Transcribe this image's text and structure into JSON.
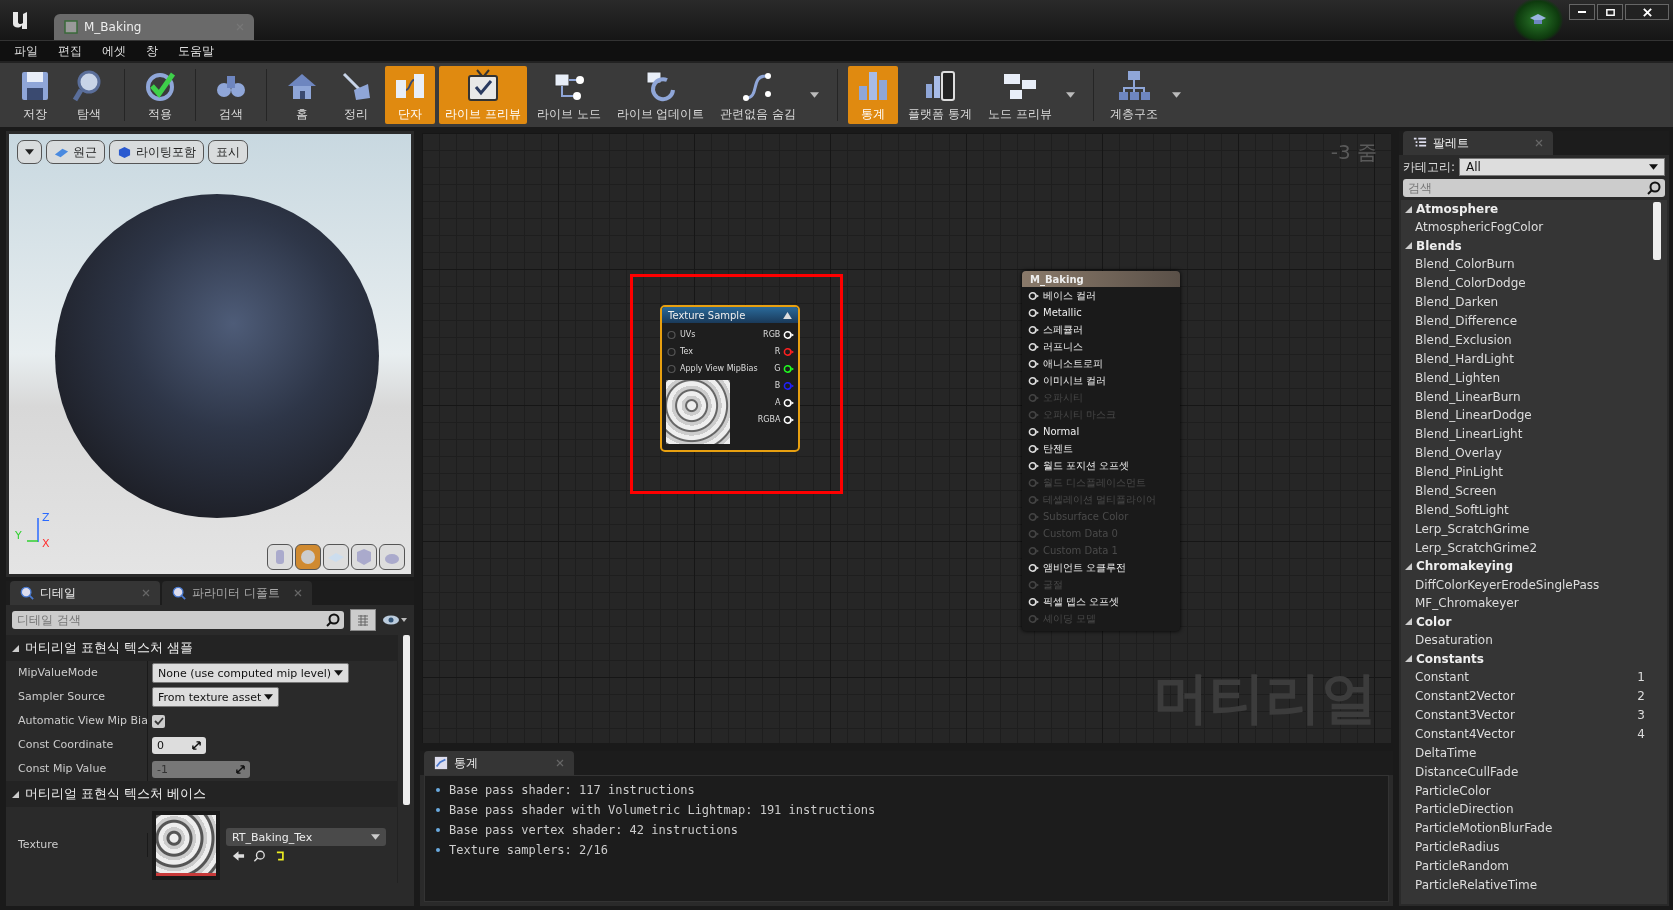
{
  "window": {
    "tab": "M_Baking"
  },
  "menu": [
    "파일",
    "편집",
    "에셋",
    "창",
    "도움말"
  ],
  "toolbar_groups": [
    [
      {
        "label": "저장",
        "selected": false,
        "dropdown": false
      },
      {
        "label": "탐색",
        "selected": false,
        "dropdown": false
      }
    ],
    [
      {
        "label": "적용",
        "selected": false,
        "dropdown": false
      }
    ],
    [
      {
        "label": "검색",
        "selected": false,
        "dropdown": false
      }
    ],
    [
      {
        "label": "홈",
        "selected": false,
        "dropdown": false
      },
      {
        "label": "정리",
        "selected": false,
        "dropdown": false
      },
      {
        "label": "단자",
        "selected": true,
        "dropdown": false
      },
      {
        "label": "라이브 프리뷰",
        "selected": true,
        "dropdown": false
      },
      {
        "label": "라이브 노드",
        "selected": false,
        "dropdown": false
      },
      {
        "label": "라이브 업데이트",
        "selected": false,
        "dropdown": false
      },
      {
        "label": "관련없음 숨김",
        "selected": false,
        "dropdown": true
      }
    ],
    [
      {
        "label": "통계",
        "selected": true,
        "dropdown": false
      },
      {
        "label": "플랫폼 통계",
        "selected": false,
        "dropdown": false
      },
      {
        "label": "노드 프리뷰",
        "selected": false,
        "dropdown": true
      }
    ],
    [
      {
        "label": "계층구조",
        "selected": false,
        "dropdown": true
      }
    ]
  ],
  "viewport": {
    "buttons": [
      {
        "kind": "dropdown"
      },
      {
        "kind": "perspective",
        "label": "원근"
      },
      {
        "kind": "lit",
        "label": "라이팅포함"
      },
      {
        "kind": "text",
        "label": "표시"
      }
    ],
    "axes": {
      "z": "Z",
      "y": "Y",
      "x": "X"
    },
    "shapes": [
      {
        "selected": false
      },
      {
        "selected": true
      },
      {
        "selected": false
      },
      {
        "selected": false
      },
      {
        "selected": false
      }
    ]
  },
  "details": {
    "tabs": [
      {
        "label": "디테일",
        "selected": true
      },
      {
        "label": "파라미터 디폴트",
        "selected": false
      }
    ],
    "search": {
      "placeholder": "디테일 검색"
    },
    "sections": [
      {
        "title": "머티리얼 표현식 텍스처 샘플",
        "expanded": true,
        "properties": [
          {
            "label": "MipValueMode",
            "kind": "dropdown",
            "value": "None (use computed mip level)"
          },
          {
            "label": "Sampler Source",
            "kind": "dropdown",
            "value": "From texture asset"
          },
          {
            "label": "Automatic View Mip Bia",
            "kind": "checkbox",
            "checked": true
          },
          {
            "label": "Const Coordinate",
            "kind": "number",
            "value": "0",
            "disabled": false
          },
          {
            "label": "Const Mip Value",
            "kind": "number",
            "value": "-1",
            "disabled": true
          }
        ]
      },
      {
        "title": "머티리얼 표현식 텍스처 베이스",
        "expanded": true,
        "properties": [
          {
            "label": "Texture",
            "kind": "texture",
            "value": "RT_Baking_Tex"
          }
        ]
      }
    ]
  },
  "graph": {
    "zoom": "-3 줌",
    "type_label": "머티리얼",
    "texture_node": {
      "title": "Texture Sample",
      "selected": true,
      "inputs": [
        "UVs",
        "Tex",
        "Apply View MipBias"
      ],
      "outputs": [
        {
          "label": "RGB",
          "color": "#ffffff"
        },
        {
          "label": "R",
          "color": "#ff2020"
        },
        {
          "label": "G",
          "color": "#20ff20"
        },
        {
          "label": "B",
          "color": "#2020ff"
        },
        {
          "label": "A",
          "color": "#ffffff"
        },
        {
          "label": "RGBA",
          "color": "#ffffff"
        }
      ]
    },
    "result_node": {
      "title": "M_Baking",
      "pins": [
        {
          "label": "베이스 컬러",
          "enabled": true
        },
        {
          "label": "Metallic",
          "enabled": true
        },
        {
          "label": "스페큘러",
          "enabled": true
        },
        {
          "label": "러프니스",
          "enabled": true
        },
        {
          "label": "애니소트로피",
          "enabled": true
        },
        {
          "label": "이미시브 컬러",
          "enabled": true
        },
        {
          "label": "오파시티",
          "enabled": false
        },
        {
          "label": "오파시티 마스크",
          "enabled": false
        },
        {
          "label": "Normal",
          "enabled": true
        },
        {
          "label": "탄젠트",
          "enabled": true
        },
        {
          "label": "월드 포지션 오프셋",
          "enabled": true
        },
        {
          "label": "월드 디스플레이스먼트",
          "enabled": false
        },
        {
          "label": "테셀레이션 멀티플라이어",
          "enabled": false
        },
        {
          "label": "Subsurface Color",
          "enabled": false
        },
        {
          "label": "Custom Data 0",
          "enabled": false
        },
        {
          "label": "Custom Data 1",
          "enabled": false
        },
        {
          "label": "앰비언트 오클루전",
          "enabled": true
        },
        {
          "label": "굴절",
          "enabled": false
        },
        {
          "label": "픽셀 뎁스 오프셋",
          "enabled": true
        },
        {
          "label": "셰이딩 모델",
          "enabled": false
        }
      ]
    }
  },
  "stats": {
    "tab": "통계",
    "lines": [
      "Base pass shader: 117 instructions",
      "Base pass shader with Volumetric Lightmap: 191 instructions",
      "Base pass vertex shader: 42 instructions",
      "Texture samplers: 2/16"
    ]
  },
  "palette": {
    "tab": "팔레트",
    "category_label": "카테고리:",
    "category": "All",
    "search": {
      "placeholder": "검색"
    },
    "groups": [
      {
        "name": "Atmosphere",
        "expanded": true,
        "items": [
          {
            "name": "AtmosphericFogColor"
          }
        ]
      },
      {
        "name": "Blends",
        "expanded": true,
        "items": [
          {
            "name": "Blend_ColorBurn"
          },
          {
            "name": "Blend_ColorDodge"
          },
          {
            "name": "Blend_Darken"
          },
          {
            "name": "Blend_Difference"
          },
          {
            "name": "Blend_Exclusion"
          },
          {
            "name": "Blend_HardLight"
          },
          {
            "name": "Blend_Lighten"
          },
          {
            "name": "Blend_LinearBurn"
          },
          {
            "name": "Blend_LinearDodge"
          },
          {
            "name": "Blend_LinearLight"
          },
          {
            "name": "Blend_Overlay"
          },
          {
            "name": "Blend_PinLight"
          },
          {
            "name": "Blend_Screen"
          },
          {
            "name": "Blend_SoftLight"
          },
          {
            "name": "Lerp_ScratchGrime"
          },
          {
            "name": "Lerp_ScratchGrime2"
          }
        ]
      },
      {
        "name": "Chromakeying",
        "expanded": true,
        "items": [
          {
            "name": "DiffColorKeyerErodeSinglePass"
          },
          {
            "name": "MF_Chromakeyer"
          }
        ]
      },
      {
        "name": "Color",
        "expanded": true,
        "items": [
          {
            "name": "Desaturation"
          }
        ]
      },
      {
        "name": "Constants",
        "expanded": true,
        "items": [
          {
            "name": "Constant",
            "hotkey": "1"
          },
          {
            "name": "Constant2Vector",
            "hotkey": "2"
          },
          {
            "name": "Constant3Vector",
            "hotkey": "3"
          },
          {
            "name": "Constant4Vector",
            "hotkey": "4"
          },
          {
            "name": "DeltaTime"
          },
          {
            "name": "DistanceCullFade"
          },
          {
            "name": "ParticleColor"
          },
          {
            "name": "ParticleDirection"
          },
          {
            "name": "ParticleMotionBlurFade"
          },
          {
            "name": "ParticleRadius"
          },
          {
            "name": "ParticleRandom"
          },
          {
            "name": "ParticleRelativeTime"
          }
        ]
      }
    ]
  }
}
